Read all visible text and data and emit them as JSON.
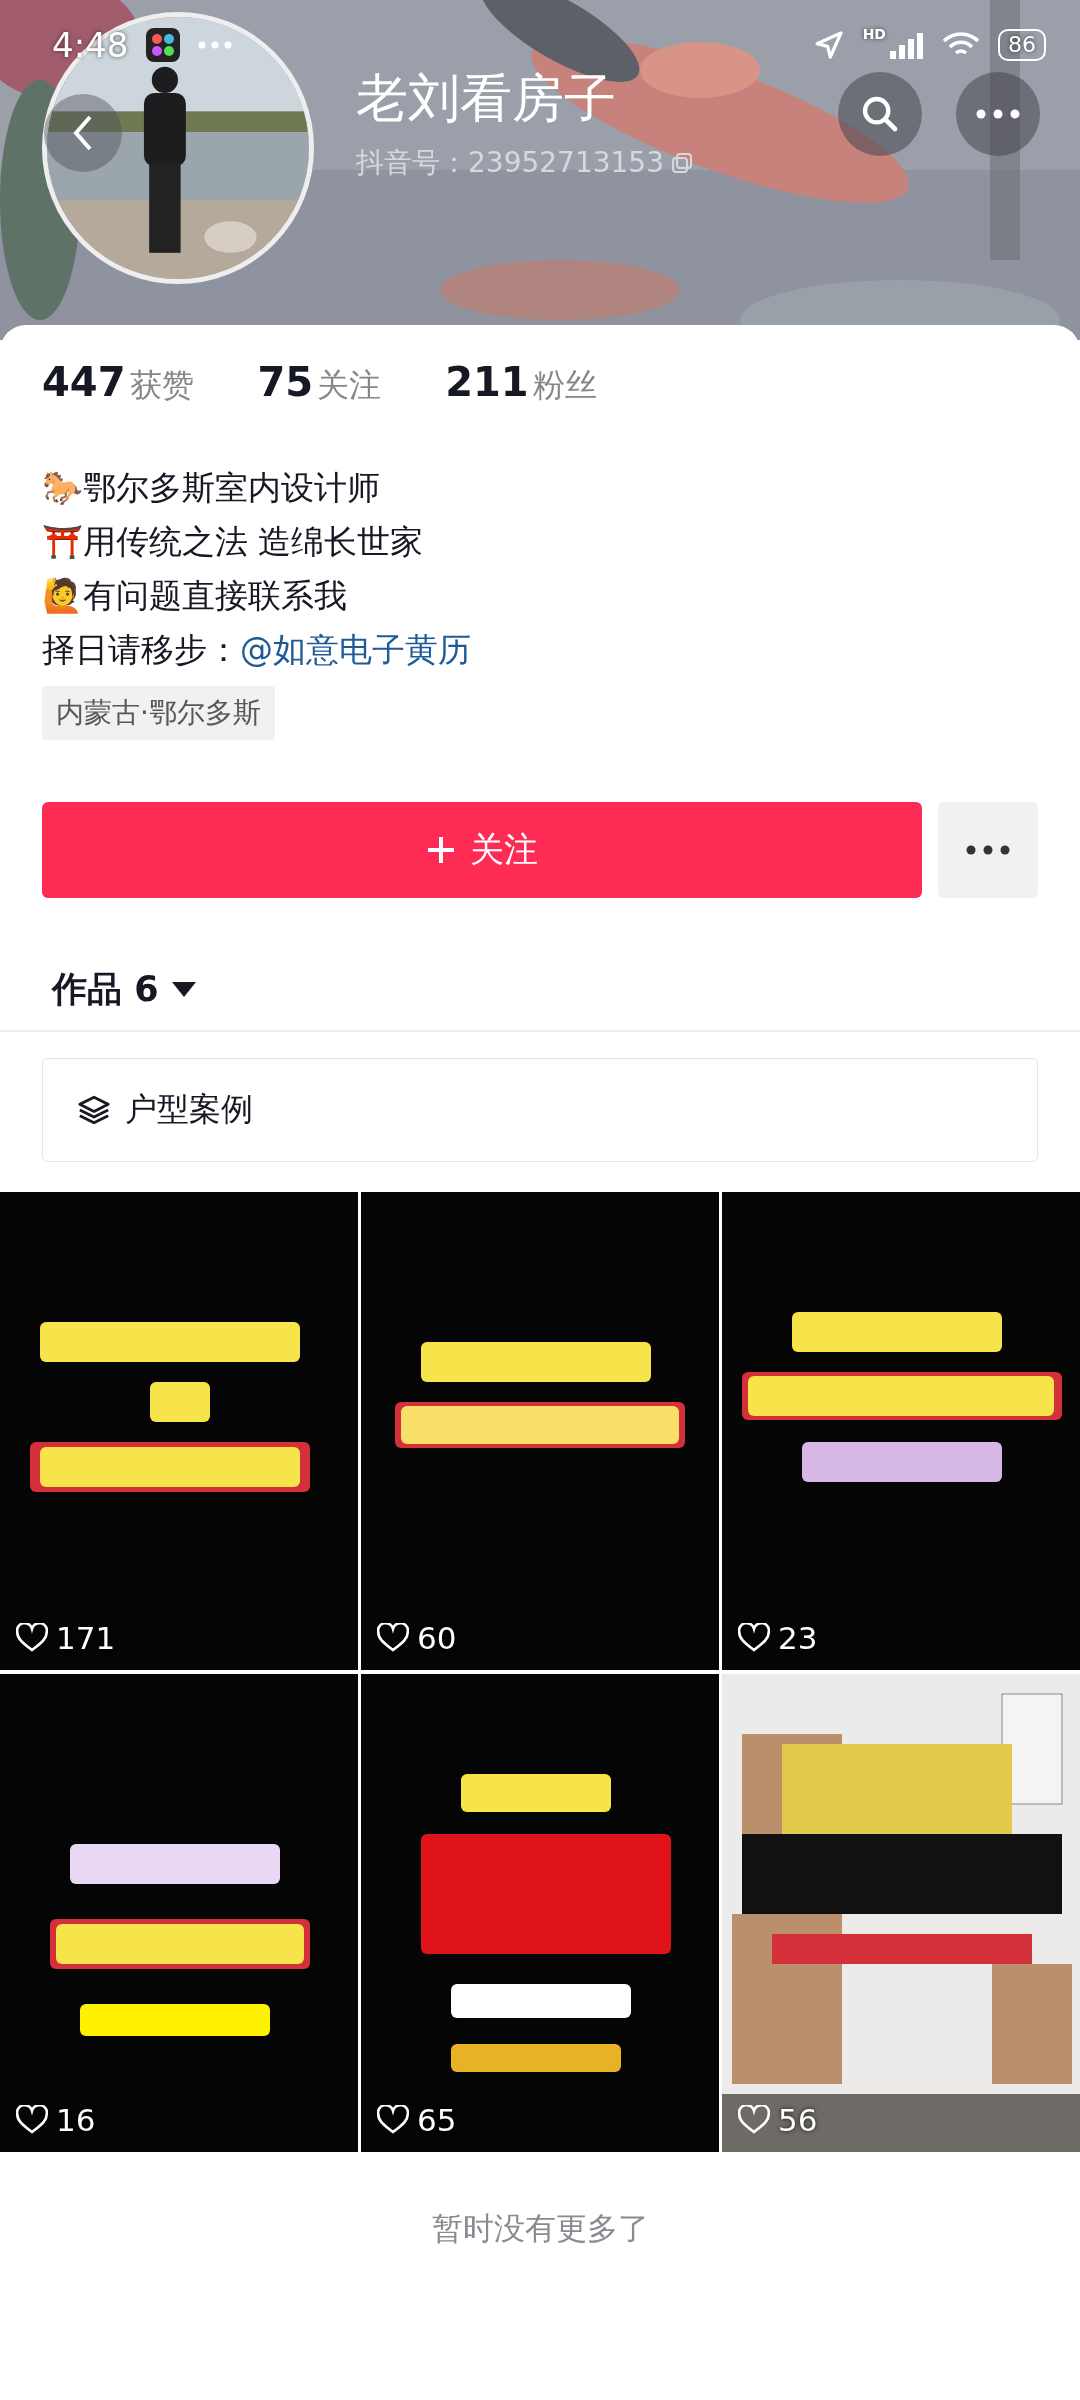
{
  "status_bar": {
    "time": "4:48",
    "network_label": "HD",
    "battery": "86"
  },
  "profile": {
    "name": "老刘看房子",
    "id_label": "抖音号：23952713153"
  },
  "stats": [
    {
      "value": "447",
      "label": "获赞"
    },
    {
      "value": "75",
      "label": "关注"
    },
    {
      "value": "211",
      "label": "粉丝"
    }
  ],
  "bio": [
    {
      "text": "🐎鄂尔多斯室内设计师"
    },
    {
      "text": "⛩️用传统之法 造绵长世家"
    },
    {
      "text": "🙋有问题直接联系我"
    },
    {
      "text": "择日请移步：",
      "link": "@如意电子黄历"
    }
  ],
  "location_tag": "内蒙古·鄂尔多斯",
  "follow_button": "关注",
  "works_tab": {
    "label": "作品 6",
    "selected": true
  },
  "collection": "户型案例",
  "videos": [
    {
      "likes": "171"
    },
    {
      "likes": "60"
    },
    {
      "likes": "23"
    },
    {
      "likes": "16"
    },
    {
      "likes": "65"
    },
    {
      "likes": "56"
    }
  ],
  "footer": "暂时没有更多了"
}
